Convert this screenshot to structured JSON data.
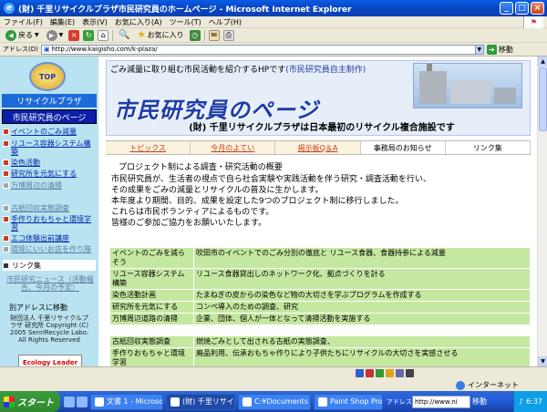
{
  "window": {
    "title": "(財) 千里リサイクルプラザ市民研究員のホームページ - Microsoft Internet Explorer",
    "min": "_",
    "max": "□",
    "close": "×"
  },
  "menu": [
    "ファイル(F)",
    "編集(E)",
    "表示(V)",
    "お気に入り(A)",
    "ツール(T)",
    "ヘルプ(H)"
  ],
  "toolbar": {
    "back": "戻る",
    "favorites": "お気に入り"
  },
  "address": {
    "label": "アドレス(D)",
    "url": "http://www.kaigisho.com/k-plaza/",
    "go": "移動"
  },
  "sidebar": {
    "logo": "TOP",
    "plaza": "リサイクルプラザ",
    "title": "市民研究員のページ",
    "items": [
      {
        "label": "イベントのごみ減量",
        "muted": false
      },
      {
        "label": "リユース容器システム構築",
        "muted": false
      },
      {
        "label": "染色活動",
        "muted": false
      },
      {
        "label": "研究所を元気にする",
        "muted": false
      },
      {
        "label": "万博周辺の清掃",
        "muted": true
      },
      {
        "label": "古紙回収実態調査",
        "muted": true
      },
      {
        "label": "手作りおもちゃと環境学習",
        "muted": false
      },
      {
        "label": "エコ体験出前講座",
        "muted": false
      },
      {
        "label": "環境にいいお店を作り隊",
        "muted": true
      }
    ],
    "link_header": "リンク集",
    "news": "市民研究ニュース（活動報告、今月の予定）",
    "other_address": "別アドレスに移動",
    "corp": "財団法人 千里リサイクルプラザ 研究所 Copyright (C) 2005 SenriRecycle Labo. All Rights Reserved",
    "banner": "Ecology Leader"
  },
  "header": {
    "lead": "ごみ減量に取り組む市民活動を紹介するHPです",
    "lead_sub": "(市民研究員自主制作)",
    "title": "市民研究員のページ",
    "strap": "(財) 千里リサイクルプラザは日本最初のリサイクル複合施設です"
  },
  "tabs": [
    {
      "label": "トピックス",
      "link": true
    },
    {
      "label": "今月のよてい",
      "link": true
    },
    {
      "label": "掲示板Q＆A",
      "link": true
    },
    {
      "label": "事務局のお知らせ",
      "link": false
    },
    {
      "label": "リンク集",
      "link": false
    }
  ],
  "intro": {
    "heading": "プロジェクト制による調査・研究活動の概要",
    "lines": [
      "市民研究員が、生活者の視点で自ら社会実験や実践活動を伴う研究・調査活動を行い、",
      "その成果をごみの減量とリサイクルの普及に生かします。",
      "本年度より期間、目的、成果を設定した9つのプロジェクト制に移行しました。",
      "これらは市民ボランティアによるものです。",
      "皆様のご参加ご協力をお願いいたします。"
    ]
  },
  "projects": [
    {
      "name": "イベントのごみを減らそう",
      "desc": "吹田市のイベントでのごみ分別の徹底と リユース食器、食器持参による減量"
    },
    {
      "name": "リユース容器システム構築",
      "desc": "リユース食器貸出しのネットワーク化、拠点づくりを計る"
    },
    {
      "name": "染色活動計画",
      "desc": "たまねぎの皮からの染色など物の大切さを学ぶプログラムを作成する"
    },
    {
      "name": "研究所を元気にする",
      "desc": "コンペ導入のための調査、研究"
    },
    {
      "name": "万博周辺道路の清掃",
      "desc": "企業、団体、個人が一体となって清掃活動を実施する"
    },
    {
      "gap": true
    },
    {
      "name": "古紙回収実態調査",
      "desc": "燃焼ごみとして出される古紙の実態調査、"
    },
    {
      "name": "手作りおもちゃと環境学習",
      "desc": "廃品利用、伝承おもちゃ作りにより子供たちにリサイクルの大切さを実感させる"
    }
  ],
  "status": {
    "zone": "インターネット"
  },
  "taskbar": {
    "start": "スタート",
    "tasks": [
      {
        "label": "文書 1 - Microsof...",
        "active": false
      },
      {
        "label": "(財) 千里リサイク...",
        "active": true
      },
      {
        "label": "C:¥Documents an...",
        "active": false
      },
      {
        "label": "Paint Shop Pro",
        "active": false
      }
    ],
    "addr_label": "アドレス",
    "addr_url": "http://www.ni",
    "go": "移動",
    "time": "6:37"
  }
}
